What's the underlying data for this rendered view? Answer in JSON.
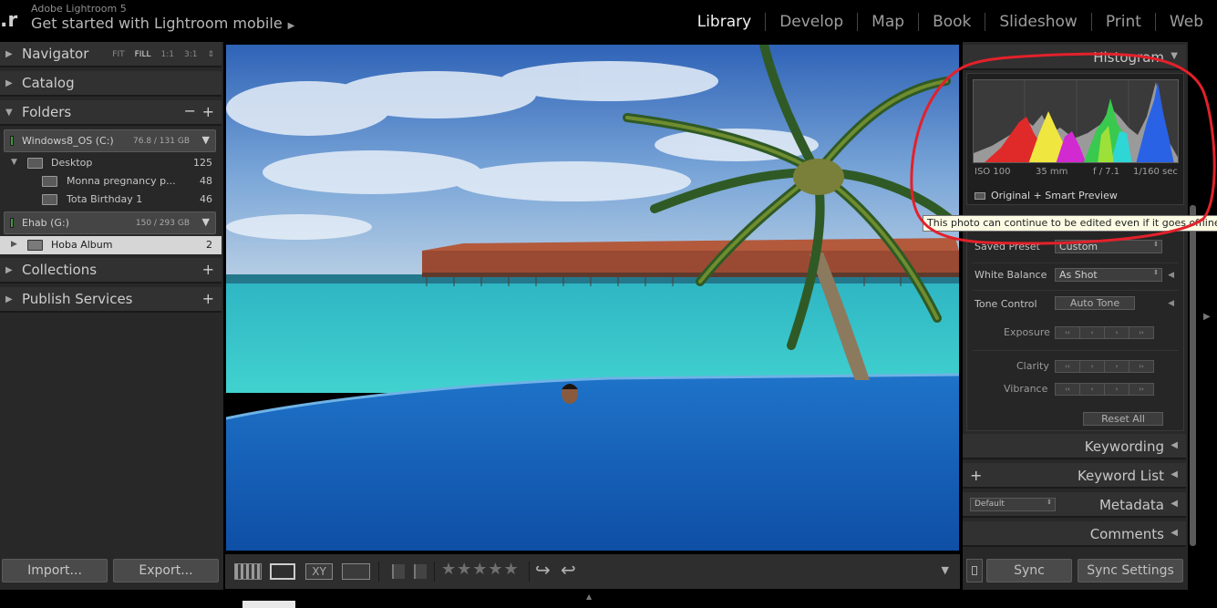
{
  "app": {
    "name": "Adobe Lightroom 5",
    "identity_plate": "Get started with Lightroom mobile",
    "identity_arrow": "▶",
    "logo": ".r"
  },
  "modules": [
    "Library",
    "Develop",
    "Map",
    "Book",
    "Slideshow",
    "Print",
    "Web"
  ],
  "active_module": "Library",
  "left_panel": {
    "navigator": {
      "label": "Navigator",
      "zoom": [
        "FIT",
        "FILL",
        "1:1",
        "3:1"
      ],
      "zoom_selected": "FILL",
      "spinner": "⇕"
    },
    "catalog": {
      "label": "Catalog"
    },
    "folders": {
      "label": "Folders",
      "minus": "−",
      "plus": "+",
      "volumes": [
        {
          "name": "Windows8_OS (C:)",
          "size": "76.8 / 131 GB",
          "dd": "▼"
        },
        {
          "name": "Ehab (G:)",
          "size": "150 / 293 GB",
          "dd": "▼"
        }
      ],
      "rows": [
        {
          "name": "Desktop",
          "count": "125"
        },
        {
          "name": "Monna pregnancy p...",
          "count": "48"
        },
        {
          "name": "Tota Birthday 1",
          "count": "46"
        },
        {
          "name": "Hoba Album",
          "count": "2"
        }
      ]
    },
    "collections": {
      "label": "Collections",
      "plus": "+"
    },
    "publish_services": {
      "label": "Publish Services",
      "plus": "+"
    },
    "import_label": "Import...",
    "export_label": "Export..."
  },
  "toolbar": {
    "stars": "★★★★★",
    "rotate_ccw": "↩",
    "rotate_cw": "↪",
    "dropdown": "▼",
    "compare_label": "XY"
  },
  "right_panel": {
    "histogram": {
      "label": "Histogram",
      "iso": "ISO 100",
      "focal": "35 mm",
      "aperture": "f / 7.1",
      "shutter": "1/160 sec",
      "preview_status": "Original + Smart Preview"
    },
    "tooltip": "This photo can continue to be edited even if it goes offline",
    "quick_develop": {
      "saved_preset_label": "Saved Preset",
      "saved_preset_value": "Custom",
      "white_balance_label": "White Balance",
      "white_balance_value": "As Shot",
      "tone_control_label": "Tone Control",
      "auto_tone_label": "Auto Tone",
      "exposure_label": "Exposure",
      "clarity_label": "Clarity",
      "vibrance_label": "Vibrance",
      "reset_label": "Reset All",
      "stepper": [
        "‹‹",
        "‹",
        "›",
        "››"
      ],
      "spin": "⇕"
    },
    "keywording": {
      "label": "Keywording"
    },
    "keyword_list": {
      "label": "Keyword List",
      "plus": "+"
    },
    "metadata": {
      "label": "Metadata",
      "preset": "Default"
    },
    "comments": {
      "label": "Comments"
    },
    "sync_label": "Sync",
    "sync_settings_label": "Sync Settings"
  },
  "colors": {
    "annotation": "#e3212b",
    "panel_bg": "#282828",
    "header_bg": "#313131"
  },
  "arrows": {
    "right": "▶",
    "left": "◀",
    "down": "▼"
  }
}
